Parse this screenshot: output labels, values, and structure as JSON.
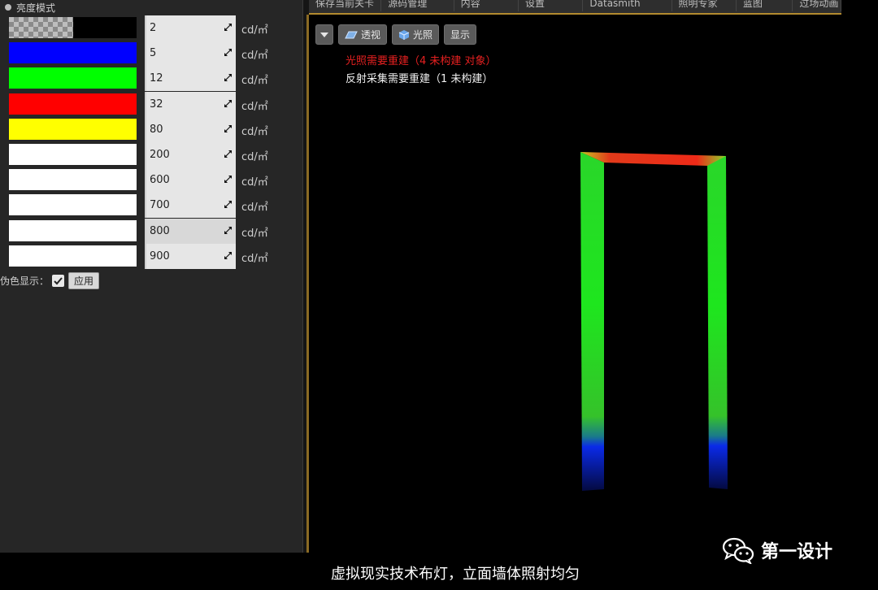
{
  "panel": {
    "mode_label": "亮度模式",
    "unit": "cd/㎡",
    "rows": [
      {
        "value": "2",
        "swatch": "#000000",
        "checker": true
      },
      {
        "value": "5",
        "swatch": "#0000ff"
      },
      {
        "value": "12",
        "swatch": "#00ff00"
      },
      {
        "value": "32",
        "swatch": "#ff0000"
      },
      {
        "value": "80",
        "swatch": "#ffff00"
      },
      {
        "value": "200",
        "swatch": "#ffffff"
      },
      {
        "value": "600",
        "swatch": "#ffffff"
      },
      {
        "value": "700",
        "swatch": "#ffffff"
      },
      {
        "value": "800",
        "swatch": "#ffffff",
        "highlighted": true
      },
      {
        "value": "900",
        "swatch": "#ffffff"
      }
    ],
    "false_color_label": "伪色显示：",
    "false_color_checked": true,
    "apply_label": "应用"
  },
  "menu": {
    "items": [
      "保存当前关卡",
      "源码管理",
      "内容",
      "设置",
      "Datasmith",
      "照明专家",
      "蓝图",
      "过场动画"
    ]
  },
  "viewport": {
    "toolbar": {
      "perspective_label": "透视",
      "lighting_label": "光照",
      "show_label": "显示"
    },
    "warning_lighting": "光照需要重建（4 未构建 对象）",
    "warning_reflection": "反射采集需要重建（1 未构建）"
  },
  "subtitle": "虚拟现实技术布灯，立面墙体照射均匀",
  "watermark": "第一设计",
  "colors": {
    "accent": "#b28a2f",
    "warning": "#e62020"
  }
}
